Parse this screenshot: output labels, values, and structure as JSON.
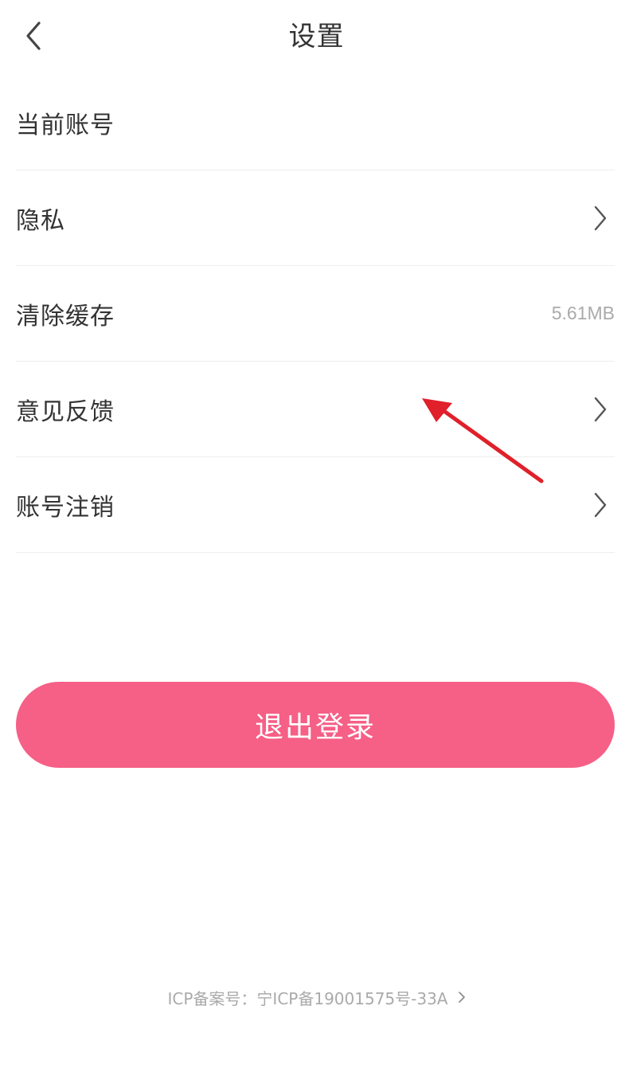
{
  "header": {
    "title": "设置",
    "back_icon": "chevron-left-icon"
  },
  "settings": {
    "items": [
      {
        "label": "当前账号",
        "value": "",
        "icon": ""
      },
      {
        "label": "隐私",
        "value": "",
        "icon": "chevron-right-icon"
      },
      {
        "label": "清除缓存",
        "value": "5.61MB",
        "icon": ""
      },
      {
        "label": "意见反馈",
        "value": "",
        "icon": "chevron-right-icon"
      },
      {
        "label": "账号注销",
        "value": "",
        "icon": "chevron-right-icon"
      }
    ]
  },
  "logout": {
    "label": "退出登录",
    "color": "#f65f86"
  },
  "footer": {
    "icp_text": "ICP备案号：宁ICP备19001575号-33A",
    "icon": "chevron-right-icon"
  },
  "annotation": {
    "icon": "red-arrow-icon",
    "color": "#e0202a"
  }
}
